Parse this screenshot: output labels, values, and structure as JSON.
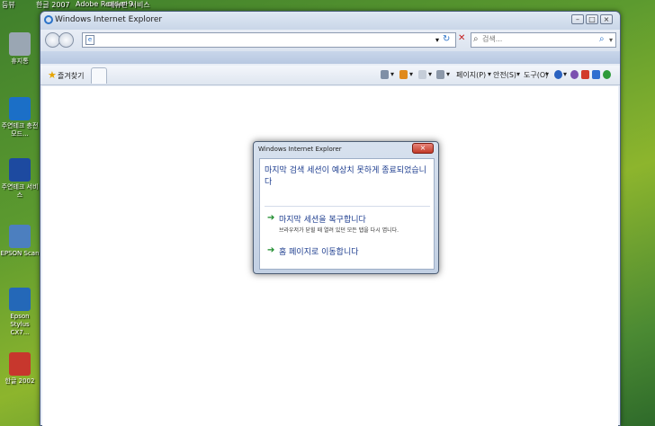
{
  "desktop": {
    "top_labels": [
      "등뷰",
      "한글 2007",
      "Adobe Reader 9",
      "메뉴판 서비스"
    ],
    "icons": [
      {
        "label": "휴지통",
        "color": "#9aa6b3"
      },
      {
        "label": "주연테크 충전모드...",
        "color": "#1b6fc7"
      },
      {
        "label": "주연테크 서비스",
        "color": "#1d4aa0"
      },
      {
        "label": "EPSON Scan",
        "color": "#4c7fbf"
      },
      {
        "label": "Epson Stylus CX7...",
        "color": "#2468b8"
      },
      {
        "label": "한글 2002",
        "color": "#c7372d"
      }
    ]
  },
  "window": {
    "title": "Windows Internet Explorer",
    "controls": {
      "minimize": "–",
      "maximize": "□",
      "close": "×"
    }
  },
  "navbar": {
    "address_value": "",
    "refresh_glyph": "↻",
    "stop_glyph": "✕",
    "search_placeholder": "검색...",
    "search_glyph": "⌕",
    "dropdown_glyph": "▾"
  },
  "commandbar": {
    "favorites_label": "즐겨찾기",
    "page_menu": "페이지(P)",
    "safety_menu": "안전(S)",
    "tools_menu": "도구(O)",
    "dropdown_glyph": "▾"
  },
  "dialog": {
    "title": "Windows Internet Explorer",
    "close_glyph": "×",
    "message": "마지막 검색 세션이 예상치 못하게 종료되었습니다",
    "option1_title": "마지막 세션을 복구합니다",
    "option1_desc": "브라우저가 닫힐 때 열려 있던 모든 탭을 다시 엽니다.",
    "option2_title": "홈 페이지로 이동합니다",
    "arrow": "➔"
  },
  "colors": {
    "link_blue": "#1d3d8f",
    "arrow_green": "#1a8a2a",
    "close_red": "#c33a28"
  }
}
